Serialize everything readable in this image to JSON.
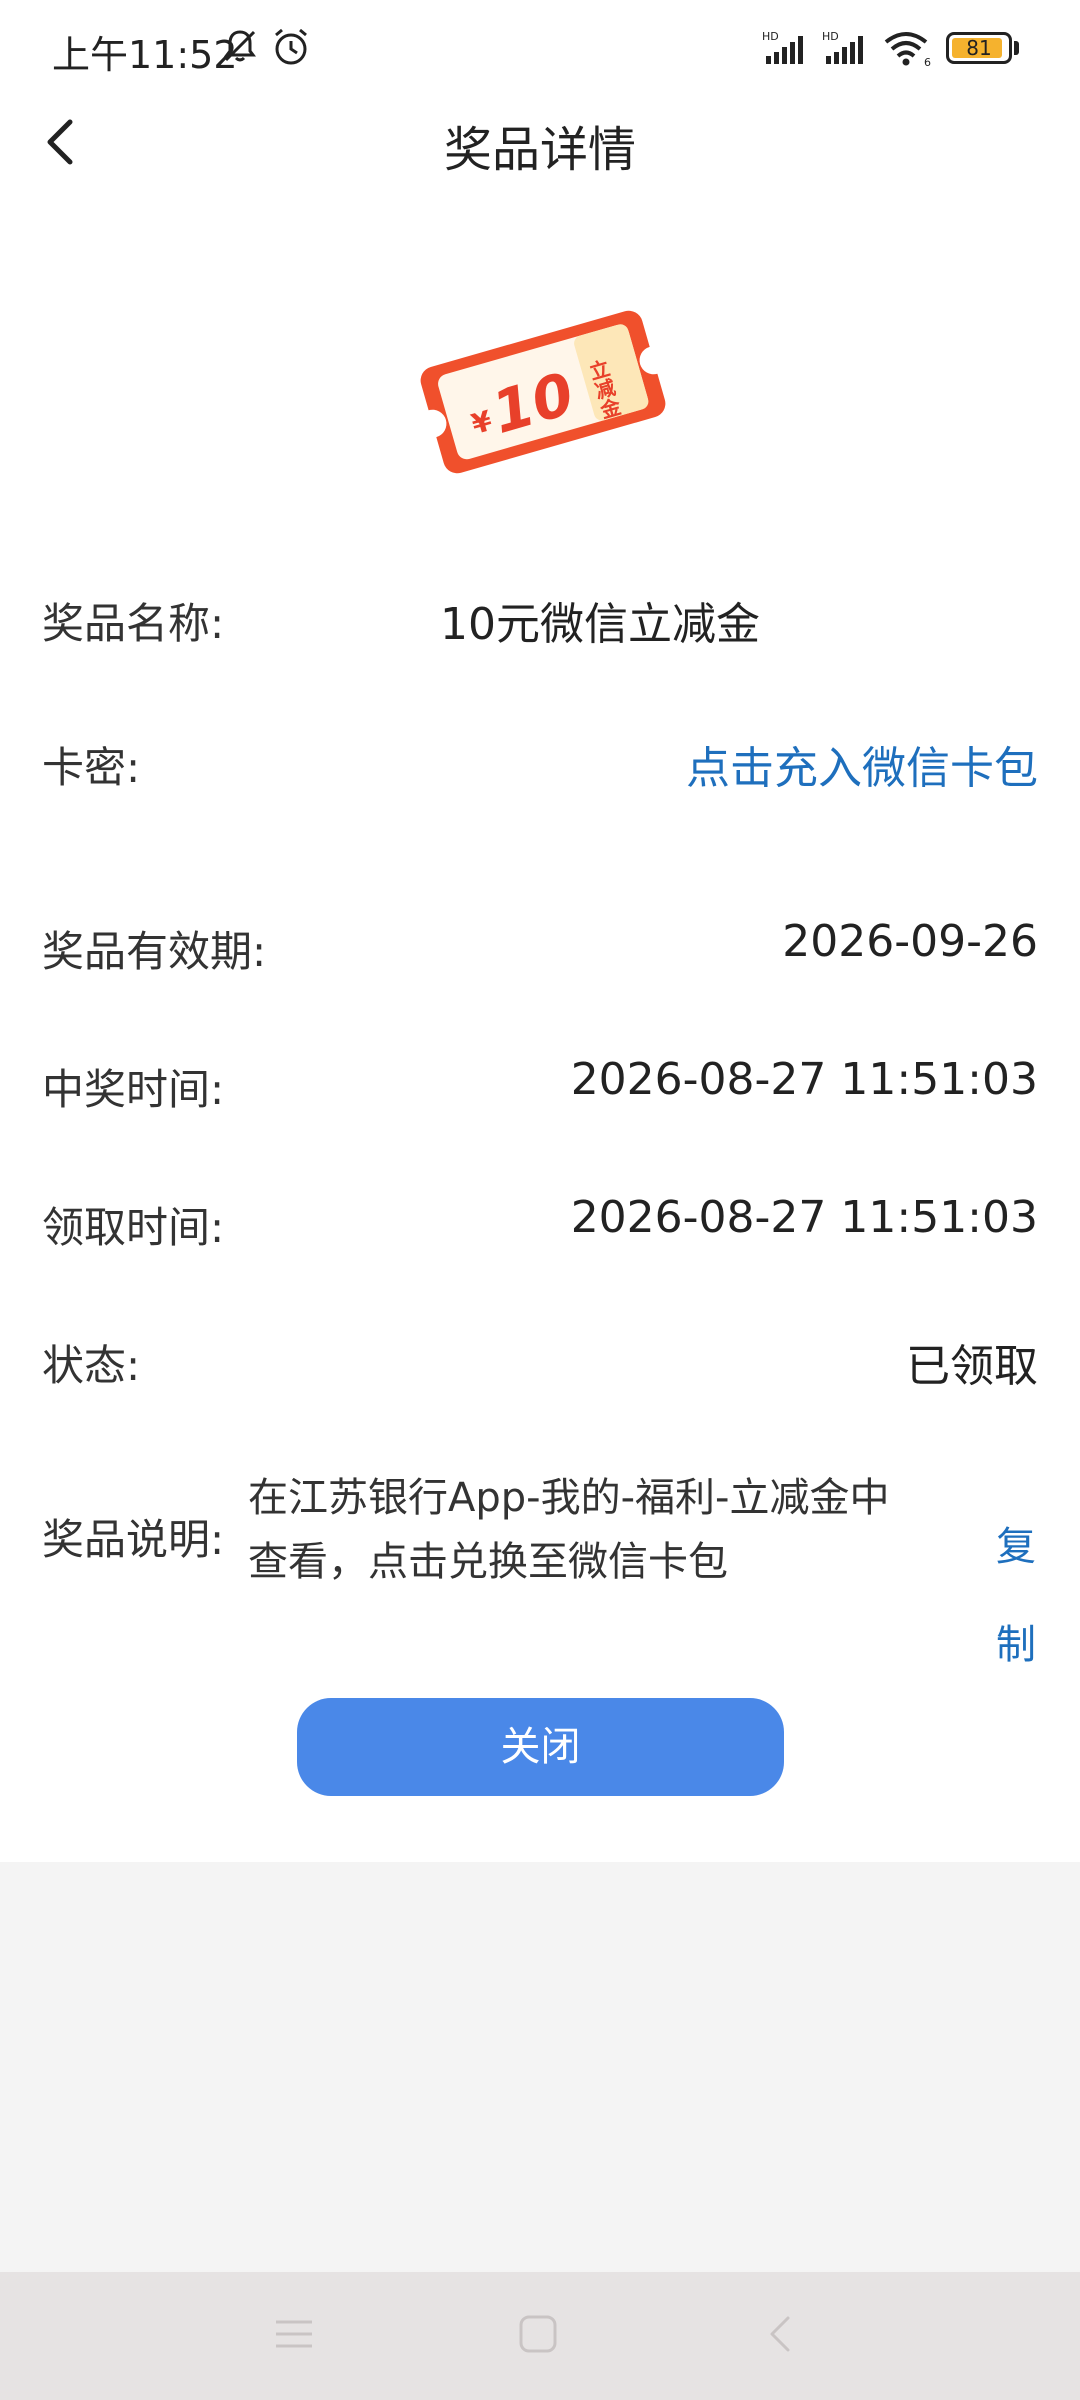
{
  "status_bar": {
    "time": "上午11:52",
    "battery_level": "81",
    "signal_labels": [
      "HD",
      "HD"
    ],
    "wifi_label": "6"
  },
  "nav": {
    "title": "奖品详情"
  },
  "coupon": {
    "currency": "¥",
    "amount": "10",
    "tag": "立减金",
    "colors": {
      "outer": "#f04a2a",
      "inner": "#fff6ea",
      "accent": "#f39c1f"
    }
  },
  "details": {
    "prize_name": {
      "label": "奖品名称:",
      "value": "10元微信立减金"
    },
    "card_secret": {
      "label": "卡密:",
      "value": "点击充入微信卡包"
    },
    "validity": {
      "label": "奖品有效期:",
      "value": "2026-09-26"
    },
    "win_time": {
      "label": "中奖时间:",
      "value": "2026-08-27 11:51:03"
    },
    "claim_time": {
      "label": "领取时间:",
      "value": "2026-08-27 11:51:03"
    },
    "status": {
      "label": "状态:",
      "value": "已领取"
    },
    "description": {
      "label": "奖品说明:",
      "line1": "在江苏银行App-我的-福利-立减金中",
      "line2": "查看，点击兑换至微信卡包",
      "copy_1": "复",
      "copy_2": "制"
    }
  },
  "actions": {
    "close_label": "关闭"
  },
  "colors": {
    "link": "#1e6fbd",
    "button": "#4a88e8",
    "page_bg": "#ffffff",
    "footer_bg": "#f4f4f4"
  }
}
